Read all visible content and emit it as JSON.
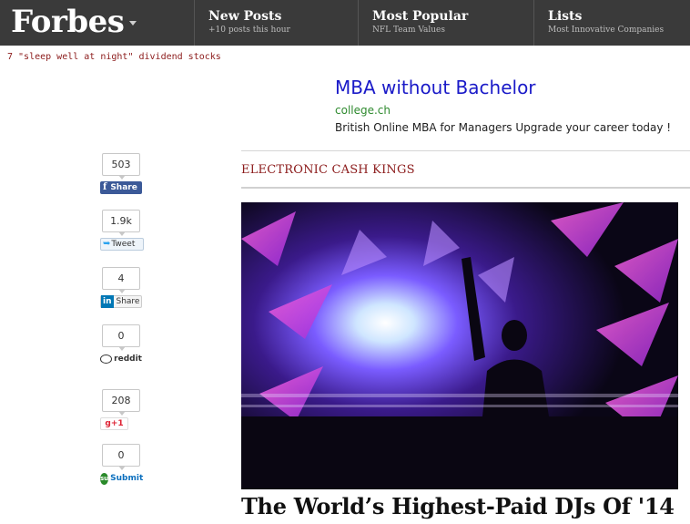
{
  "topbar": {
    "logo": "Forbes",
    "nav": [
      {
        "title": "New Posts",
        "subtitle": "+10 posts this hour"
      },
      {
        "title": "Most Popular",
        "subtitle": "NFL Team Values"
      },
      {
        "title": "Lists",
        "subtitle": "Most Innovative Companies"
      }
    ]
  },
  "teaser": "7 \"sleep well at night\" dividend stocks",
  "ad": {
    "title": "MBA without Bachelor",
    "url": "college.ch",
    "description": "British Online MBA for Managers Upgrade your career today !"
  },
  "article": {
    "section": "ELECTRONIC CASH KINGS",
    "headline": "The World’s Highest-Paid DJs Of '14"
  },
  "share": {
    "facebook": {
      "count": "503",
      "label": "Share",
      "icon": "f"
    },
    "twitter": {
      "count": "1.9k",
      "label": "Tweet"
    },
    "linkedin": {
      "count": "4",
      "label": "Share",
      "icon": "in"
    },
    "reddit": {
      "count": "0",
      "label": "reddit"
    },
    "googleplus": {
      "count": "208",
      "label": "g+1"
    },
    "stumbleupon": {
      "count": "0",
      "label": "Submit",
      "icon": "su"
    }
  },
  "colors": {
    "topbar": "#3a3a3a",
    "section_accent": "#8b1a1a",
    "ad_link": "#1a1ac8",
    "ad_url": "#2e8a2e",
    "facebook": "#3b5998",
    "linkedin": "#0077b5"
  }
}
